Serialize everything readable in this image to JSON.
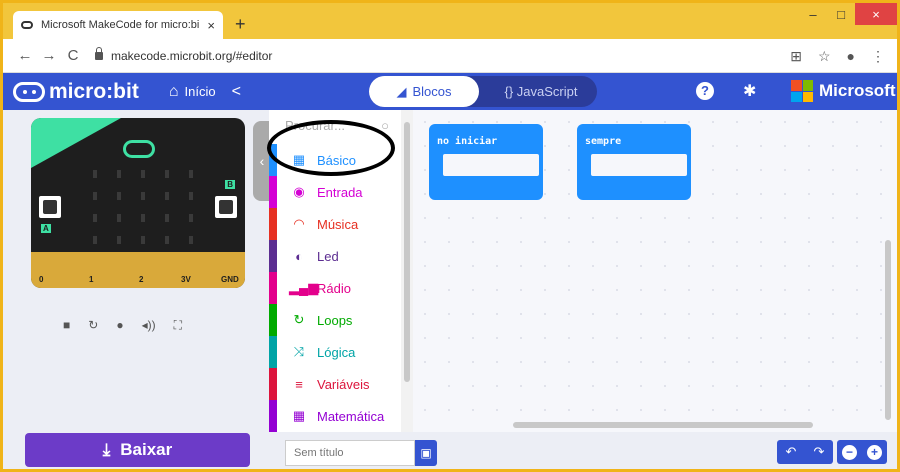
{
  "browser": {
    "tab_title": "Microsoft MakeCode for micro:bi",
    "tab_close": "×",
    "new_tab": "+",
    "url": "makecode.microbit.org/#editor",
    "back": "←",
    "forward": "→",
    "reload": "C",
    "win_min": "–",
    "win_max": "□",
    "win_close": "×",
    "translate_icon": "⊞",
    "star_icon": "☆",
    "profile_icon": "●",
    "menu_icon": "⋮"
  },
  "header": {
    "logo_text": "micro:bit",
    "home_label": "Início",
    "home_icon": "⌂",
    "share_icon": "<",
    "blocks_label": "Blocos",
    "blocks_icon": "◢",
    "js_label": "{} JavaScript",
    "help_icon": "?",
    "gear_icon": "✱",
    "ms_label": "Microsoft"
  },
  "simulator": {
    "label_a": "A",
    "label_b": "B",
    "pins": [
      "0",
      "1",
      "2",
      "3V",
      "GND"
    ],
    "toolbar_icons": [
      "■",
      "↻",
      "●",
      "◂))",
      "⛶"
    ],
    "collapse_icon": "‹"
  },
  "download": {
    "label": "Baixar",
    "icon": "⤓"
  },
  "toolbox": {
    "search_placeholder": "Procurar...",
    "search_icon": "○",
    "categories": [
      {
        "label": "Básico",
        "icon": "▦",
        "color": "#1e90ff"
      },
      {
        "label": "Entrada",
        "icon": "◉",
        "color": "#d400d4"
      },
      {
        "label": "Música",
        "icon": "◠",
        "color": "#e63022"
      },
      {
        "label": "Led",
        "icon": "◐",
        "color": "#5c2d91"
      },
      {
        "label": "Rádio",
        "icon": "▂▄▆",
        "color": "#e3008c"
      },
      {
        "label": "Loops",
        "icon": "↻",
        "color": "#00aa00"
      },
      {
        "label": "Lógica",
        "icon": "⤨",
        "color": "#00a4a6"
      },
      {
        "label": "Variáveis",
        "icon": "≡",
        "color": "#dc143c"
      },
      {
        "label": "Matemática",
        "icon": "▦",
        "color": "#9400d3"
      }
    ]
  },
  "workspace": {
    "blocks": [
      {
        "label": "no iniciar"
      },
      {
        "label": "sempre"
      }
    ]
  },
  "bottom": {
    "project_name_placeholder": "Sem título",
    "save_icon": "▣",
    "undo_icon": "↶",
    "redo_icon": "↷",
    "zoom_out_icon": "−",
    "zoom_in_icon": "+"
  },
  "colors": {
    "header_blue": "#3454d1",
    "block_blue": "#1e90ff",
    "download_purple": "#6c3bc8",
    "board_green": "#3ee0a3"
  }
}
